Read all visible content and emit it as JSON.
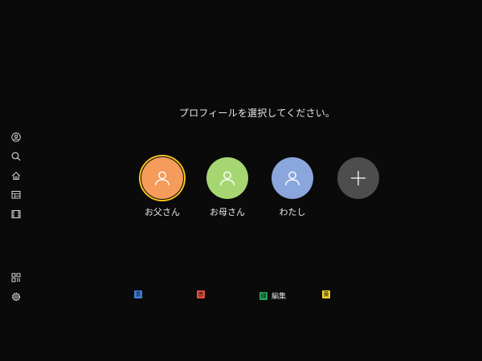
{
  "prompt": "プロフィールを選択してください。",
  "profiles": [
    {
      "name": "お父さん",
      "color": "#f59b5b",
      "selected": true
    },
    {
      "name": "お母さん",
      "color": "#a6d672",
      "selected": false
    },
    {
      "name": "わたし",
      "color": "#8aa6dc",
      "selected": false
    }
  ],
  "add_button": {
    "color": "#4d4d4d",
    "icon": "plus-icon"
  },
  "selection_color": "#f6c21c",
  "sidebar": {
    "items": [
      {
        "icon": "profile-icon"
      },
      {
        "icon": "search-icon"
      },
      {
        "icon": "home-icon"
      },
      {
        "icon": "tv-guide-icon"
      },
      {
        "icon": "video-library-icon"
      },
      {
        "icon": "qr-code-icon"
      },
      {
        "icon": "settings-icon"
      }
    ]
  },
  "color_keys": [
    {
      "color": "#3b7fd9",
      "glyph": "青",
      "label": ""
    },
    {
      "color": "#e0503a",
      "glyph": "赤",
      "label": ""
    },
    {
      "color": "#23a35a",
      "glyph": "緑",
      "label": "編集"
    },
    {
      "color": "#f2d22a",
      "glyph": "黄",
      "label": ""
    }
  ]
}
